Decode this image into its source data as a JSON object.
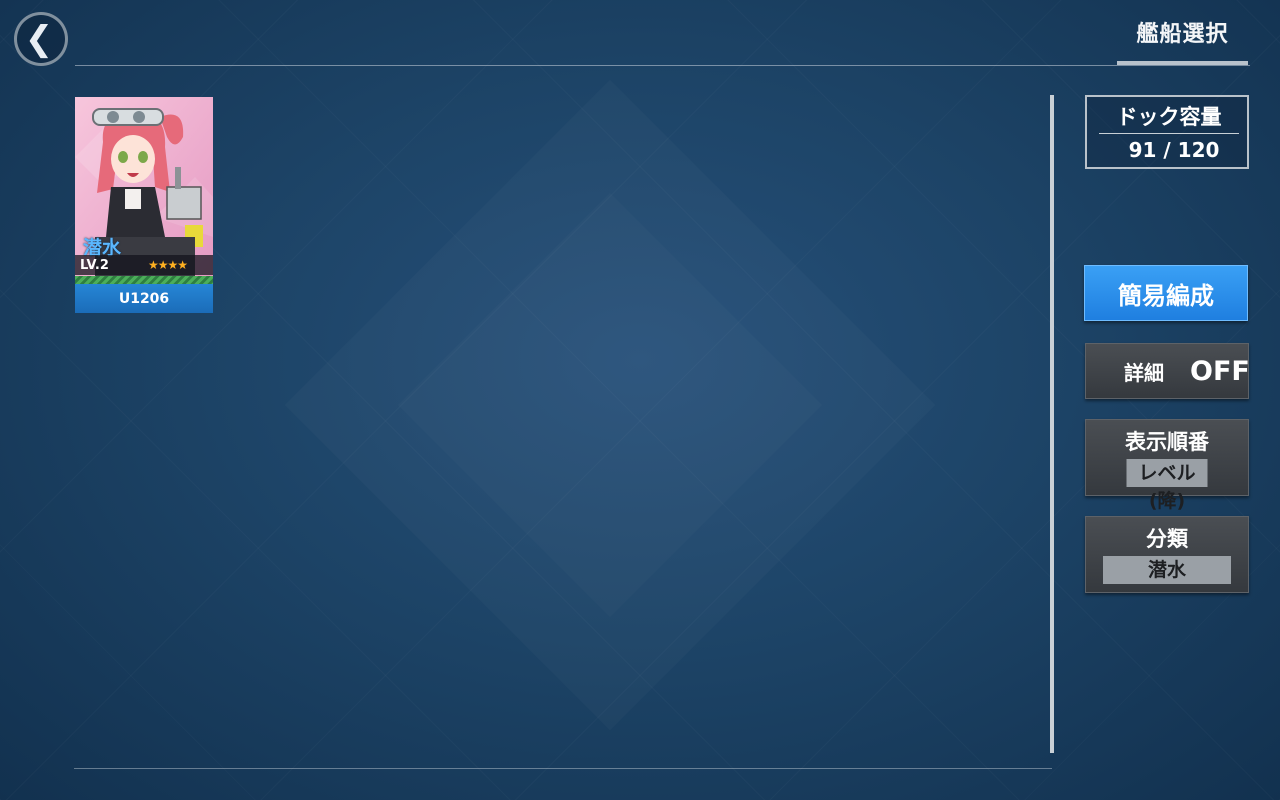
{
  "header": {
    "title": "艦船選択"
  },
  "ship_card": {
    "type": "潜水",
    "level": "LV.2",
    "stars": "★★★★",
    "name": "U1206"
  },
  "dock": {
    "label": "ドック容量",
    "value": "91 / 120"
  },
  "buttons": {
    "quick_formation": "簡易編成",
    "detail_label": "詳細",
    "detail_value": "OFF",
    "order_label": "表示順番",
    "order_value": "レベル(降)",
    "class_label": "分類",
    "class_value": "潜水"
  },
  "colors": {
    "accent": "#2a8ef0",
    "card_name_bg": "#1b6cb8",
    "stars": "#ffb020"
  }
}
